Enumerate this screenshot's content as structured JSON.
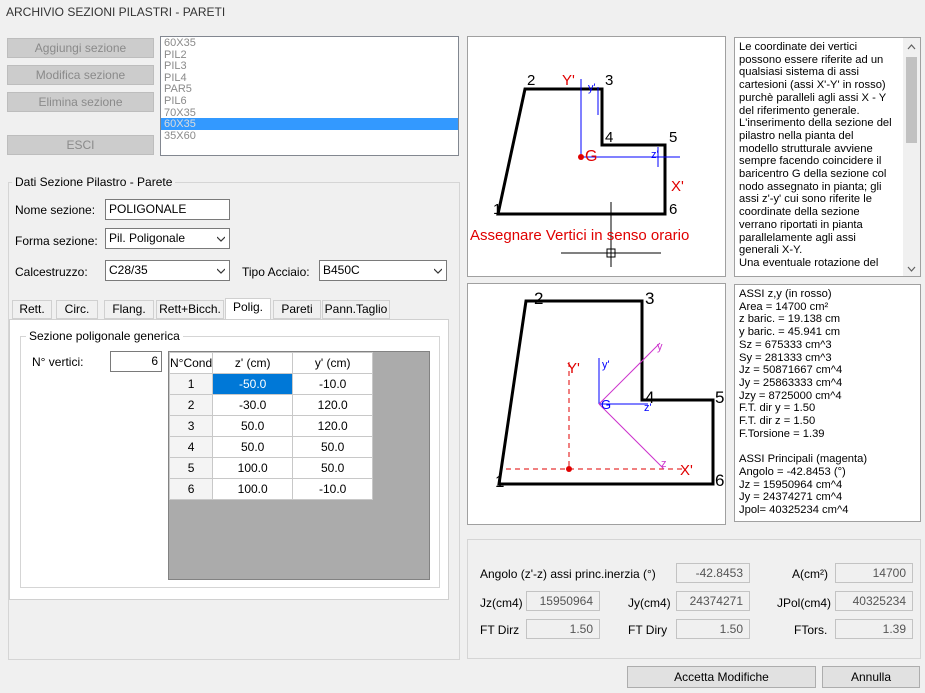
{
  "window": {
    "title": "ARCHIVIO SEZIONI PILASTRI - PARETI"
  },
  "buttons": {
    "add": "Aggiungi sezione",
    "modify": "Modifica sezione",
    "delete": "Elimina sezione",
    "exit": "ESCI",
    "accept": "Accetta Modifiche",
    "cancel": "Annulla"
  },
  "section_list": {
    "items": [
      "60X35",
      "PIL2",
      "PIL3",
      "PIL4",
      "PAR5",
      "PIL6",
      "70X35",
      "60X35",
      "35X60"
    ],
    "selected_index": 7
  },
  "section_data": {
    "group_title": "Dati Sezione Pilastro - Parete",
    "name_label": "Nome sezione:",
    "name_value": "POLIGONALE",
    "shape_label": "Forma sezione:",
    "shape_value": "Pil. Poligonale",
    "concrete_label": "Calcestruzzo:",
    "concrete_value": "C28/35",
    "steel_label": "Tipo Acciaio:",
    "steel_value": "B450C"
  },
  "tabs": [
    "Rett.",
    "Circ.",
    "Flang.",
    "Rett+Bicch.",
    "Polig.",
    "Pareti",
    "Pann.Taglio"
  ],
  "active_tab": 4,
  "polygon": {
    "group_title": "Sezione poligonale generica",
    "vertices_label": "N° vertici:",
    "vertices_value": "6",
    "headers": [
      "N°Cond",
      "z' (cm)",
      "y' (cm)"
    ],
    "rows": [
      [
        "1",
        "-50.0",
        "-10.0"
      ],
      [
        "2",
        "-30.0",
        "120.0"
      ],
      [
        "3",
        "50.0",
        "120.0"
      ],
      [
        "4",
        "50.0",
        "50.0"
      ],
      [
        "5",
        "100.0",
        "50.0"
      ],
      [
        "6",
        "100.0",
        "-10.0"
      ]
    ]
  },
  "drawing_top": {
    "vertex_labels": [
      "1",
      "2",
      "3",
      "4",
      "5",
      "6"
    ],
    "axis_y_red": "Y'",
    "axis_y_blue": "y'",
    "axis_z_blue": "z'",
    "axis_x_red": "X'",
    "centroid": "G",
    "instruction": "Assegnare Vertici in senso orario"
  },
  "drawing_bottom": {
    "vertex_labels": [
      "1",
      "2",
      "3",
      "4",
      "5",
      "6"
    ],
    "axis_y_red": "Y'",
    "axis_y_blue": "y'",
    "axis_z_blue": "z'",
    "axis_x_red": "X'",
    "axis_y_mag": "y",
    "axis_z_mag": "z",
    "centroid": "G"
  },
  "help_text": [
    "Le coordinate dei vertici",
    "possono essere riferite ad un",
    "qualsiasi sistema di assi",
    "cartesioni (assi X'-Y' in rosso)",
    "purchè paralleli agli assi X - Y",
    "del riferimento generale.",
    "L'inserimento della sezione del",
    "pilastro nella pianta del",
    "modello strutturale avviene",
    "sempre facendo coincidere il",
    "baricentro G della sezione col",
    "nodo assegnato in pianta;  gli",
    "assi z'-y' cui sono riferite le",
    "coordinate della sezione",
    "verrano riportati in pianta",
    "parallelamente agli assi",
    "generali X-Y.",
    "Una eventuale rotazione del"
  ],
  "properties_text": [
    "ASSI z,y (in rosso)",
    "Area = 14700 cm²",
    "z baric. = 19.138 cm",
    "y baric. = 45.941 cm",
    "Sz  = 675333 cm^3",
    "Sy  = 281333 cm^3",
    "Jz  = 50871667 cm^4",
    "Jy  = 25863333 cm^4",
    "Jzy = 8725000 cm^4",
    "F.T. dir y  = 1.50",
    "F.T. dir z  = 1.50",
    "F.Torsione  = 1.39",
    "",
    "ASSI Principali (magenta)",
    "Angolo = -42.8453 (°)",
    "Jz  = 15950964 cm^4",
    "Jy  = 24374271 cm^4",
    "Jpol= 40325234 cm^4"
  ],
  "results": {
    "angle_label": "Angolo (z'-z) assi princ.inerzia (°)",
    "angle_value": "-42.8453",
    "area_label": "A(cm²)",
    "area_value": "14700",
    "jz_label": "Jz(cm4)",
    "jz_value": "15950964",
    "jy_label": "Jy(cm4)",
    "jy_value": "24374271",
    "jpol_label": "JPol(cm4)",
    "jpol_value": "40325234",
    "ftdirz_label": "FT Dirz",
    "ftdirz_value": "1.50",
    "ftdiry_label": "FT Diry",
    "ftdiry_value": "1.50",
    "ftors_label": "FTors.",
    "ftors_value": "1.39"
  },
  "colors": {
    "red": "#e00000",
    "blue": "#0000ff",
    "magenta": "#cc33cc",
    "selection": "#3399ff"
  }
}
